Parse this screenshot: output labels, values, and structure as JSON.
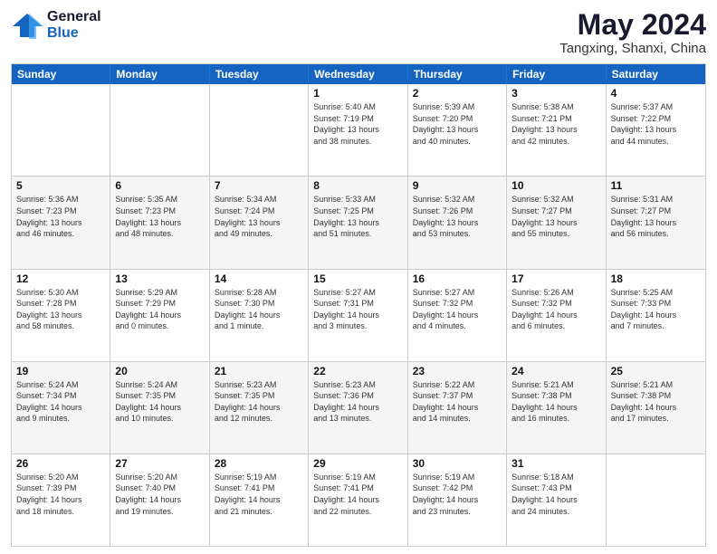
{
  "header": {
    "logo_general": "General",
    "logo_blue": "Blue",
    "month_title": "May 2024",
    "location": "Tangxing, Shanxi, China"
  },
  "calendar": {
    "days_of_week": [
      "Sunday",
      "Monday",
      "Tuesday",
      "Wednesday",
      "Thursday",
      "Friday",
      "Saturday"
    ],
    "weeks": [
      {
        "alt": false,
        "cells": [
          {
            "day": "",
            "info": ""
          },
          {
            "day": "",
            "info": ""
          },
          {
            "day": "",
            "info": ""
          },
          {
            "day": "1",
            "info": "Sunrise: 5:40 AM\nSunset: 7:19 PM\nDaylight: 13 hours\nand 38 minutes."
          },
          {
            "day": "2",
            "info": "Sunrise: 5:39 AM\nSunset: 7:20 PM\nDaylight: 13 hours\nand 40 minutes."
          },
          {
            "day": "3",
            "info": "Sunrise: 5:38 AM\nSunset: 7:21 PM\nDaylight: 13 hours\nand 42 minutes."
          },
          {
            "day": "4",
            "info": "Sunrise: 5:37 AM\nSunset: 7:22 PM\nDaylight: 13 hours\nand 44 minutes."
          }
        ]
      },
      {
        "alt": true,
        "cells": [
          {
            "day": "5",
            "info": "Sunrise: 5:36 AM\nSunset: 7:23 PM\nDaylight: 13 hours\nand 46 minutes."
          },
          {
            "day": "6",
            "info": "Sunrise: 5:35 AM\nSunset: 7:23 PM\nDaylight: 13 hours\nand 48 minutes."
          },
          {
            "day": "7",
            "info": "Sunrise: 5:34 AM\nSunset: 7:24 PM\nDaylight: 13 hours\nand 49 minutes."
          },
          {
            "day": "8",
            "info": "Sunrise: 5:33 AM\nSunset: 7:25 PM\nDaylight: 13 hours\nand 51 minutes."
          },
          {
            "day": "9",
            "info": "Sunrise: 5:32 AM\nSunset: 7:26 PM\nDaylight: 13 hours\nand 53 minutes."
          },
          {
            "day": "10",
            "info": "Sunrise: 5:32 AM\nSunset: 7:27 PM\nDaylight: 13 hours\nand 55 minutes."
          },
          {
            "day": "11",
            "info": "Sunrise: 5:31 AM\nSunset: 7:27 PM\nDaylight: 13 hours\nand 56 minutes."
          }
        ]
      },
      {
        "alt": false,
        "cells": [
          {
            "day": "12",
            "info": "Sunrise: 5:30 AM\nSunset: 7:28 PM\nDaylight: 13 hours\nand 58 minutes."
          },
          {
            "day": "13",
            "info": "Sunrise: 5:29 AM\nSunset: 7:29 PM\nDaylight: 14 hours\nand 0 minutes."
          },
          {
            "day": "14",
            "info": "Sunrise: 5:28 AM\nSunset: 7:30 PM\nDaylight: 14 hours\nand 1 minute."
          },
          {
            "day": "15",
            "info": "Sunrise: 5:27 AM\nSunset: 7:31 PM\nDaylight: 14 hours\nand 3 minutes."
          },
          {
            "day": "16",
            "info": "Sunrise: 5:27 AM\nSunset: 7:32 PM\nDaylight: 14 hours\nand 4 minutes."
          },
          {
            "day": "17",
            "info": "Sunrise: 5:26 AM\nSunset: 7:32 PM\nDaylight: 14 hours\nand 6 minutes."
          },
          {
            "day": "18",
            "info": "Sunrise: 5:25 AM\nSunset: 7:33 PM\nDaylight: 14 hours\nand 7 minutes."
          }
        ]
      },
      {
        "alt": true,
        "cells": [
          {
            "day": "19",
            "info": "Sunrise: 5:24 AM\nSunset: 7:34 PM\nDaylight: 14 hours\nand 9 minutes."
          },
          {
            "day": "20",
            "info": "Sunrise: 5:24 AM\nSunset: 7:35 PM\nDaylight: 14 hours\nand 10 minutes."
          },
          {
            "day": "21",
            "info": "Sunrise: 5:23 AM\nSunset: 7:35 PM\nDaylight: 14 hours\nand 12 minutes."
          },
          {
            "day": "22",
            "info": "Sunrise: 5:23 AM\nSunset: 7:36 PM\nDaylight: 14 hours\nand 13 minutes."
          },
          {
            "day": "23",
            "info": "Sunrise: 5:22 AM\nSunset: 7:37 PM\nDaylight: 14 hours\nand 14 minutes."
          },
          {
            "day": "24",
            "info": "Sunrise: 5:21 AM\nSunset: 7:38 PM\nDaylight: 14 hours\nand 16 minutes."
          },
          {
            "day": "25",
            "info": "Sunrise: 5:21 AM\nSunset: 7:38 PM\nDaylight: 14 hours\nand 17 minutes."
          }
        ]
      },
      {
        "alt": false,
        "cells": [
          {
            "day": "26",
            "info": "Sunrise: 5:20 AM\nSunset: 7:39 PM\nDaylight: 14 hours\nand 18 minutes."
          },
          {
            "day": "27",
            "info": "Sunrise: 5:20 AM\nSunset: 7:40 PM\nDaylight: 14 hours\nand 19 minutes."
          },
          {
            "day": "28",
            "info": "Sunrise: 5:19 AM\nSunset: 7:41 PM\nDaylight: 14 hours\nand 21 minutes."
          },
          {
            "day": "29",
            "info": "Sunrise: 5:19 AM\nSunset: 7:41 PM\nDaylight: 14 hours\nand 22 minutes."
          },
          {
            "day": "30",
            "info": "Sunrise: 5:19 AM\nSunset: 7:42 PM\nDaylight: 14 hours\nand 23 minutes."
          },
          {
            "day": "31",
            "info": "Sunrise: 5:18 AM\nSunset: 7:43 PM\nDaylight: 14 hours\nand 24 minutes."
          },
          {
            "day": "",
            "info": ""
          }
        ]
      }
    ]
  }
}
